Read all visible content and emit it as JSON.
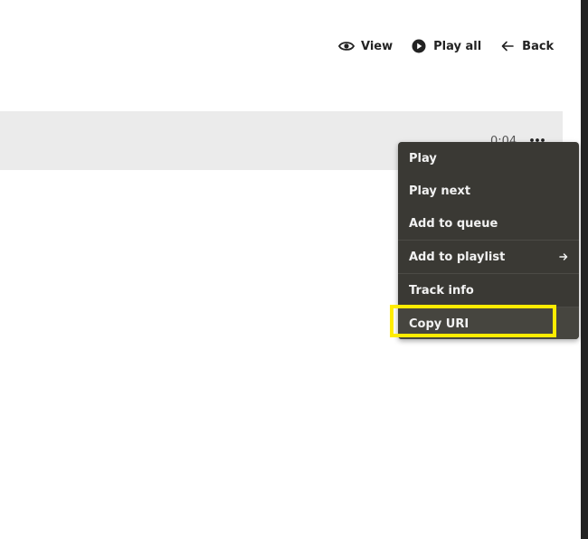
{
  "toolbar": {
    "view_label": "View",
    "play_all_label": "Play all",
    "back_label": "Back",
    "view_icon": "eye-icon",
    "play_all_icon": "play-circle-icon",
    "back_icon": "arrow-left-icon"
  },
  "track": {
    "duration": "0:04",
    "more_icon": "more-horizontal-icon"
  },
  "context_menu": {
    "items": [
      {
        "label": "Play"
      },
      {
        "label": "Play next"
      },
      {
        "label": "Add to queue"
      },
      {
        "label": "Add to playlist",
        "submenu_icon": "arrow-right-icon"
      },
      {
        "label": "Track info"
      },
      {
        "label": "Copy URI"
      }
    ]
  },
  "colors": {
    "menu_background": "#3a3934",
    "menu_text": "#f2f2f2",
    "highlight_outline": "#ffec00",
    "track_row_background": "#ebebeb",
    "right_strip": "#222222"
  }
}
